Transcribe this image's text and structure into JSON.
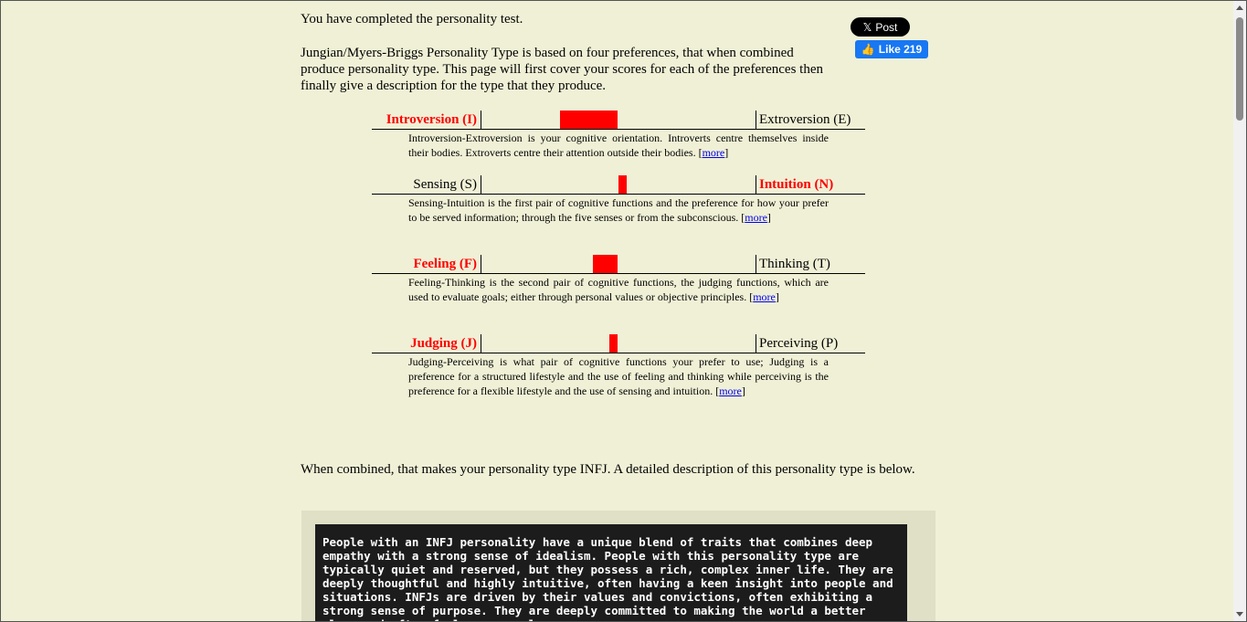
{
  "intro": {
    "completed": "You have completed the personality test.",
    "explanation": "Jungian/Myers-Briggs Personality Type is based on four preferences, that when combined produce personality type. This page will first cover your scores for each of the preferences then finally give a description for the type that they produce."
  },
  "share": {
    "twitter_icon": "x-logo-icon",
    "twitter_glyph": "𝕏",
    "twitter_label": "Post",
    "facebook_icon": "thumbs-up-icon",
    "facebook_glyph": "👍",
    "facebook_label": "Like 219",
    "twitter_color": "#000000",
    "facebook_color": "#1877f2"
  },
  "preferences": [
    {
      "left_label": "Introversion (I)",
      "right_label": "Extroversion (E)",
      "winner": "left",
      "bar_from": 0.29,
      "bar_to": 0.5,
      "description": "Introversion-Extroversion is your cognitive orientation. Introverts centre themselves inside their bodies. Extroverts centre their attention outside their bodies.",
      "more_label": "more"
    },
    {
      "left_label": "Sensing (S)",
      "right_label": "Intuition (N)",
      "winner": "right",
      "bar_from": 0.5,
      "bar_to": 0.53,
      "description": "Sensing-Intuition is the first pair of cognitive functions and the preference for how your prefer to be served information; through the five senses or from the subconscious.",
      "more_label": "more"
    },
    {
      "left_label": "Feeling (F)",
      "right_label": "Thinking (T)",
      "winner": "left",
      "bar_from": 0.41,
      "bar_to": 0.5,
      "description": "Feeling-Thinking is the second pair of cognitive functions, the judging functions, which are used to evaluate goals; either through personal values or objective principles.",
      "more_label": "more"
    },
    {
      "left_label": "Judging (J)",
      "right_label": "Perceiving (P)",
      "winner": "left",
      "bar_from": 0.47,
      "bar_to": 0.5,
      "description": "Judging-Perceiving is what pair of cognitive functions your prefer to use; Judging is a preference for a structured lifestyle and the use of feeling and thinking while perceiving is the preference for a flexible lifestyle and the use of sensing and intuition.",
      "more_label": "more"
    }
  ],
  "result": {
    "combined_text": "When combined, that makes your personality type INFJ. A detailed description of this personality type is below.",
    "description": "People with an INFJ personality have a unique blend of traits that combines deep empathy with a strong sense of idealism. People with this personality type are typically quiet and reserved, but they possess a rich, complex inner life. They are deeply thoughtful and highly intuitive, often having a keen insight into people and situations. INFJs are driven by their values and convictions, often exhibiting a strong sense of purpose. They are deeply committed to making the world a better place and often feel a personal"
  },
  "colors": {
    "background": "#f0f0d6",
    "accent_red": "#ff0000",
    "link_blue": "#0000ee",
    "terminal_bg": "#1c1c1c"
  }
}
